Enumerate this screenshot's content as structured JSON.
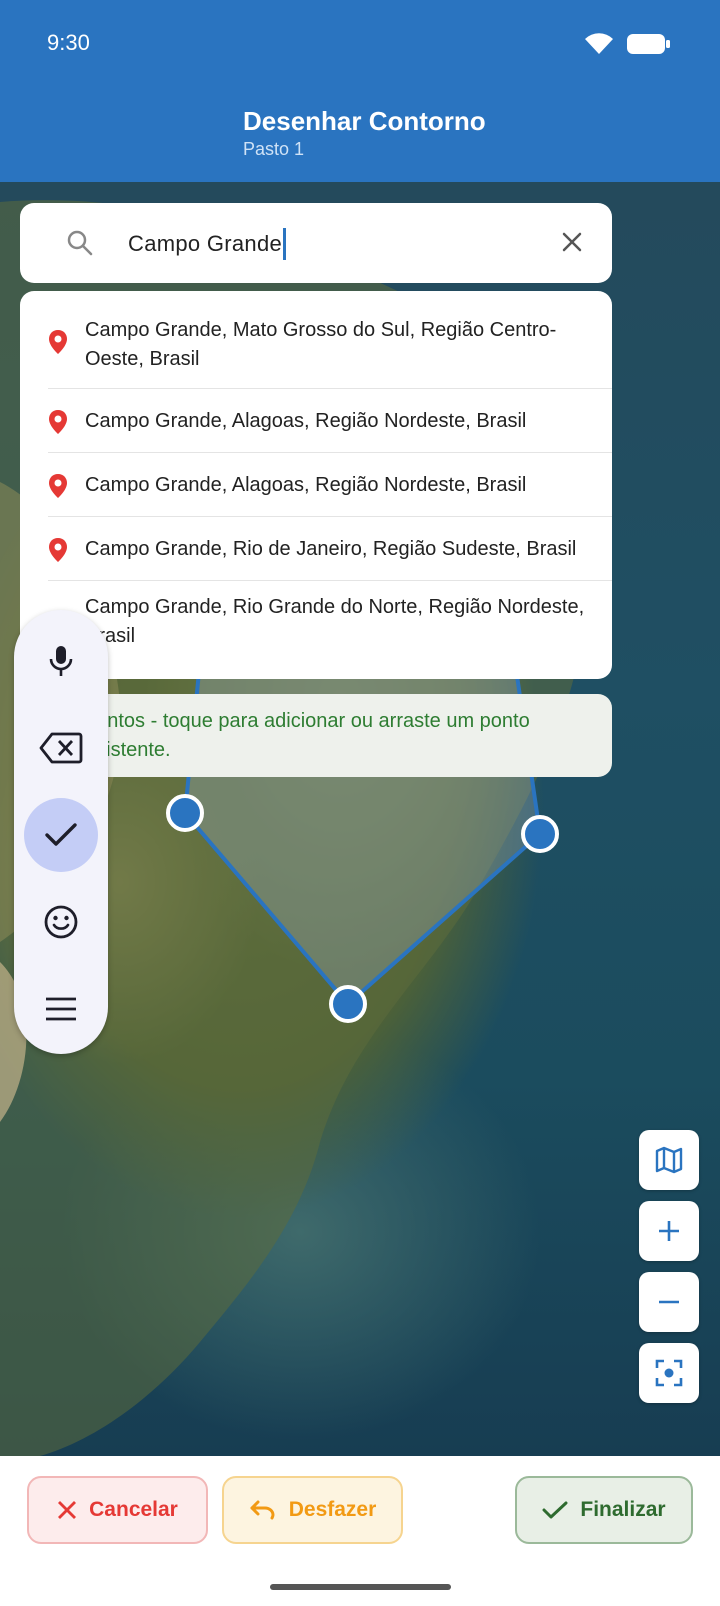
{
  "status_bar": {
    "time": "9:30"
  },
  "app_bar": {
    "title": "Desenhar Contorno",
    "subtitle": "Pasto 1"
  },
  "search": {
    "value": "Campo Grande"
  },
  "suggestions": [
    "Campo Grande, Mato Grosso do Sul, Região Centro-Oeste, Brasil",
    "Campo Grande, Alagoas, Região Nordeste, Brasil",
    "Campo Grande, Alagoas, Região Nordeste, Brasil",
    "Campo Grande, Rio de Janeiro, Região Sudeste, Brasil",
    "Campo Grande, Rio Grande do Norte, Região Nordeste, Brasil"
  ],
  "hint": "pontos - toque para adicionar ou arraste um ponto existente.",
  "toolbar": {
    "items": [
      "mic-icon",
      "backspace-icon",
      "check-icon",
      "emoji-icon",
      "menu-icon"
    ],
    "active": "check-icon"
  },
  "map_controls": [
    "map-layers-icon",
    "zoom-in-icon",
    "zoom-out-icon",
    "center-focus-icon"
  ],
  "actions": {
    "cancel_label": "Cancelar",
    "undo_label": "Desfazer",
    "finish_label": "Finalizar"
  },
  "colors": {
    "primary": "#2a74c0",
    "cancel": "#e53935",
    "undo": "#f29a14",
    "finish": "#2e6b2f",
    "hint_text": "#2e7d32"
  }
}
